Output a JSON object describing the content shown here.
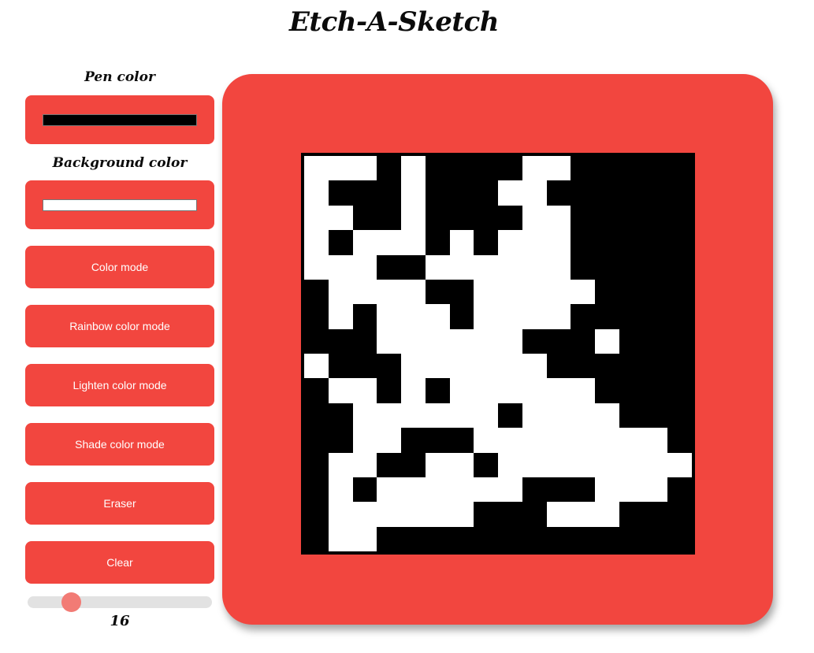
{
  "title": "Etch-A-Sketch",
  "pen": {
    "label": "Pen color",
    "value": "#000000"
  },
  "background": {
    "label": "Background color",
    "value": "#ffffff"
  },
  "buttons": {
    "color_mode": "Color mode",
    "rainbow_mode": "Rainbow color mode",
    "lighten_mode": "Lighten color mode",
    "shade_mode": "Shade color mode",
    "eraser": "Eraser",
    "clear": "Clear"
  },
  "grid_size": {
    "value": 16,
    "label": "16",
    "min": 1,
    "max": 64
  },
  "colors": {
    "accent": "#f2463f",
    "pen": "#000000",
    "background": "#ffffff"
  },
  "grid": [
    "1110100001100000",
    "1000100011000000",
    "1100100001100000",
    "1011101011100000",
    "1110011111100000",
    "0111100111110000",
    "0101110111100000",
    "0001111110001000",
    "1000111111000000",
    "0110101111110000",
    "0011111101111000",
    "0011000111111110",
    "0110011011111111",
    "0101111110001110",
    "0111111000111000",
    "0110000000000000"
  ]
}
